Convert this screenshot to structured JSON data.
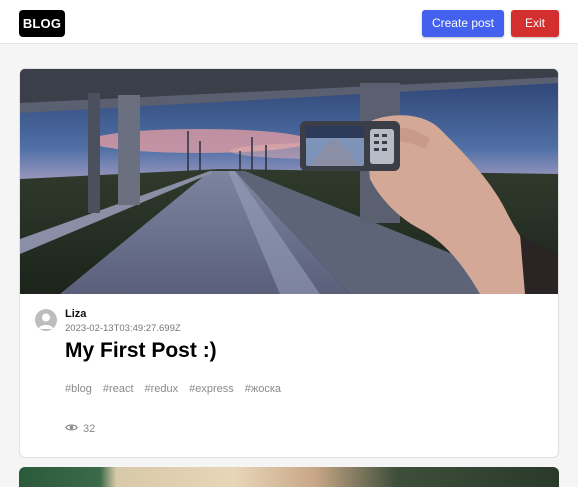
{
  "header": {
    "logo_text": "BLOG",
    "create_label": "Create post",
    "exit_label": "Exit",
    "create_color": "#4361ee",
    "exit_color": "#d32f2f"
  },
  "post": {
    "author": "Liza",
    "created_at": "2023-02-13T03:49:27.699Z",
    "title": "My First Post :)",
    "tags": [
      "#blog",
      "#react",
      "#redux",
      "#express",
      "#жоска"
    ],
    "views_icon": "eye-icon",
    "views": "32",
    "image_subject": "hand holding a phone photographing a highway under an overpass at dusk"
  }
}
